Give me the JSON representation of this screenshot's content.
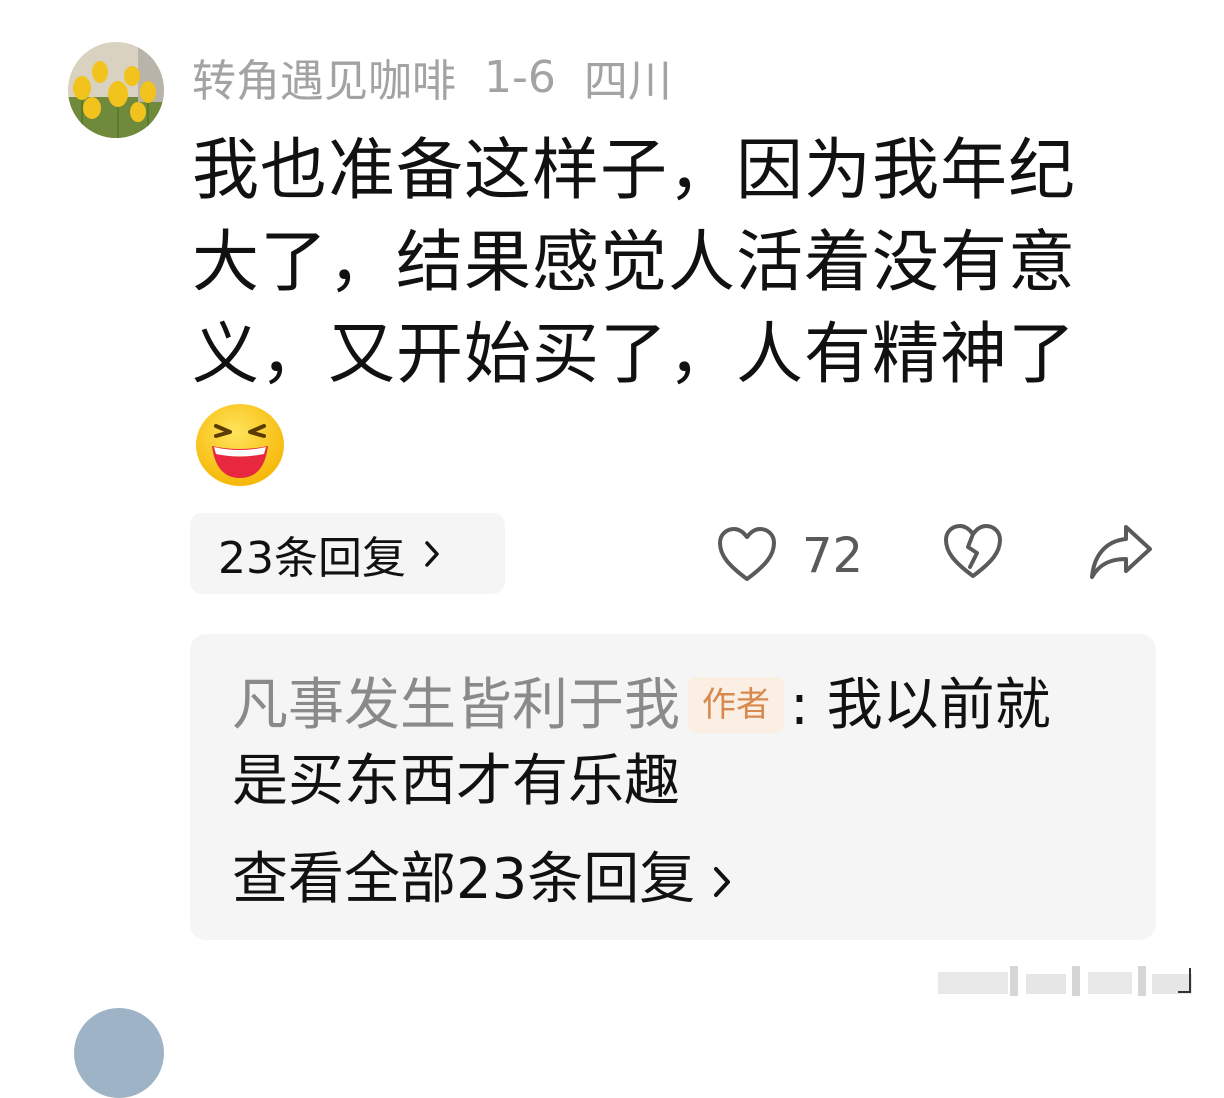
{
  "comment": {
    "username": "转角遇见咖啡",
    "date": "1-6",
    "location": "四川",
    "text": "我也准备这样子，因为我年纪大了，结果感觉人活着没有意义，又开始买了，人有精神了",
    "emoji": "laughing-emoji",
    "replies_button": "23条回复",
    "like_count": "72"
  },
  "reply_preview": {
    "author": "凡事发生皆利于我",
    "author_badge": "作者",
    "separator": ": ",
    "text": "我以前就是买东西才有乐趣",
    "view_all": "查看全部23条回复"
  },
  "icons": {
    "like": "heart-outline-icon",
    "dislike": "broken-heart-icon",
    "share": "share-arrow-icon",
    "chevron": "chevron-right-icon"
  },
  "colors": {
    "meta_text": "#a3a3a3",
    "body_text": "#111111",
    "card_bg": "#f5f5f5",
    "badge_bg": "#fbeee3",
    "badge_text": "#d8894f",
    "icon_gray": "#5a5a5a"
  }
}
